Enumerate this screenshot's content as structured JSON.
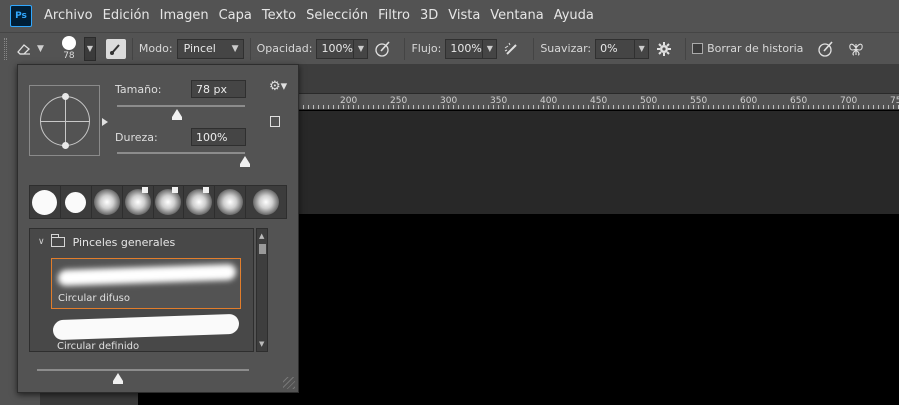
{
  "app": {
    "logo_text": "Ps"
  },
  "menu": [
    "Archivo",
    "Edición",
    "Imagen",
    "Capa",
    "Texto",
    "Selección",
    "Filtro",
    "3D",
    "Vista",
    "Ventana",
    "Ayuda"
  ],
  "options": {
    "brush_size": "78",
    "mode_label": "Modo:",
    "mode_value": "Pincel",
    "opacity_label": "Opacidad:",
    "opacity_value": "100%",
    "flow_label": "Flujo:",
    "flow_value": "100%",
    "smoothing_label": "Suavizar:",
    "smoothing_value": "0%",
    "erase_history_label": "Borrar de historia",
    "erase_history_checked": false
  },
  "ruler": {
    "labels": [
      "200",
      "250",
      "300",
      "350",
      "400",
      "450",
      "500",
      "550",
      "600",
      "650",
      "700",
      "75"
    ]
  },
  "brush_panel": {
    "size_label": "Tamaño:",
    "size_value": "78 px",
    "size_fraction": 0.47,
    "hardness_label": "Dureza:",
    "hardness_value": "100%",
    "hardness_fraction": 1.0,
    "group_name": "Pinceles generales",
    "presets": [
      {
        "name": "Circular difuso",
        "selected": true
      },
      {
        "name": "Circular definido",
        "selected": false
      }
    ],
    "preview_size_fraction": 0.38
  },
  "colors": {
    "selection_accent": "#e27d2b",
    "ps_blue": "#31a8ff",
    "chrome": "#535353"
  }
}
